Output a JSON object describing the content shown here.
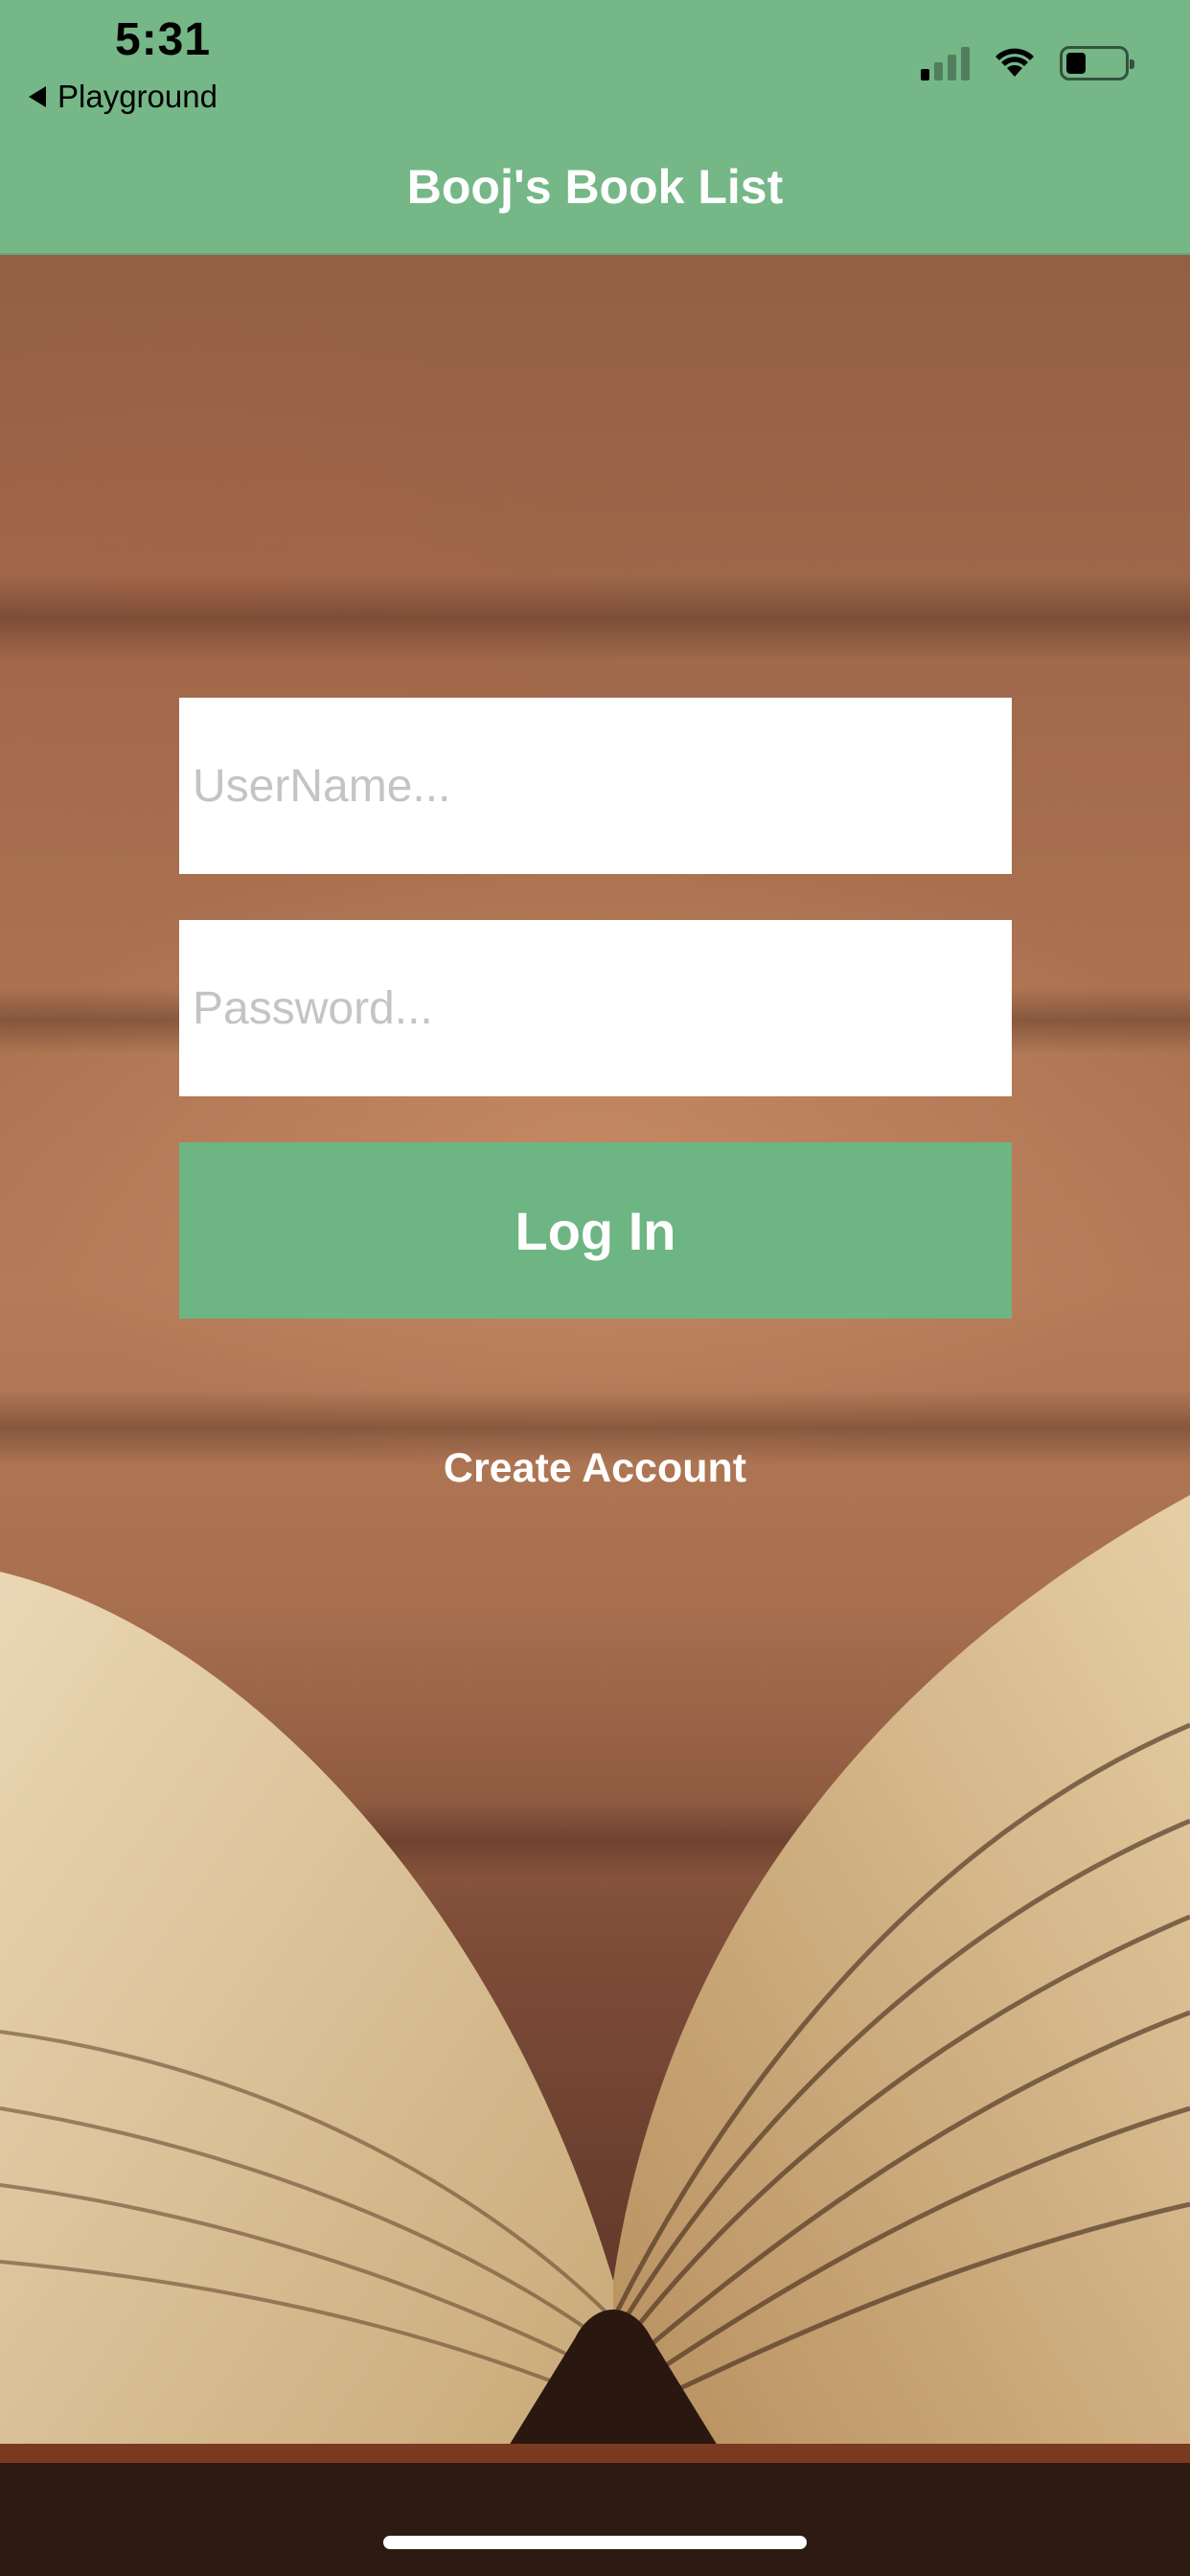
{
  "status_bar": {
    "time": "5:31",
    "back_app_label": "Playground",
    "signal_icon": "cellular-signal-icon",
    "wifi_icon": "wifi-icon",
    "battery_icon": "battery-icon",
    "battery_level": 0.35
  },
  "nav": {
    "title": "Booj's Book List"
  },
  "form": {
    "username_placeholder": "UserName...",
    "username_value": "",
    "password_placeholder": "Password...",
    "password_value": "",
    "login_label": "Log In",
    "create_account_label": "Create Account"
  },
  "colors": {
    "header_green": "#75b787",
    "button_green": "#6db582",
    "text_white": "#ffffff"
  }
}
